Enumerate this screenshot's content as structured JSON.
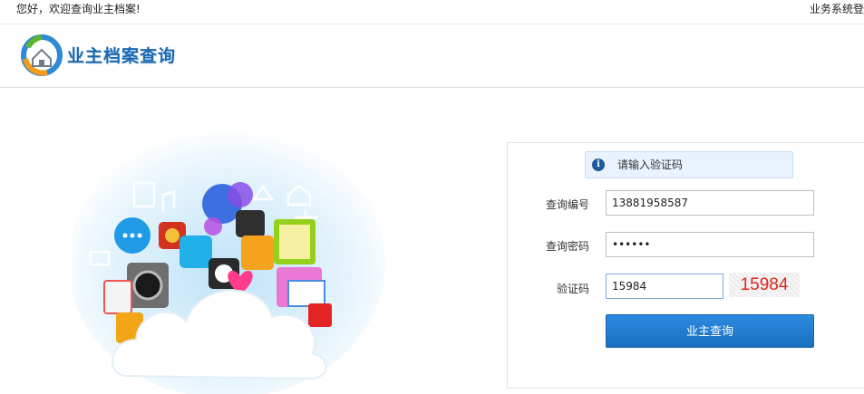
{
  "topbar": {
    "greeting": "您好，欢迎查询业主档案!",
    "system_link": "业务系统登"
  },
  "header": {
    "logo_text": "业主档案查询"
  },
  "form": {
    "tip": "请输入验证码",
    "query_no_label": "查询编号",
    "query_no_value": "13881958587",
    "password_label": "查询密码",
    "password_value": "••••••",
    "captcha_label": "验证码",
    "captcha_value": "15984",
    "captcha_image_text": "15984",
    "submit_label": "业主查询"
  },
  "colors": {
    "brand": "#1a69b0",
    "button": "#1b6fc0",
    "captcha": "#e0261c"
  }
}
